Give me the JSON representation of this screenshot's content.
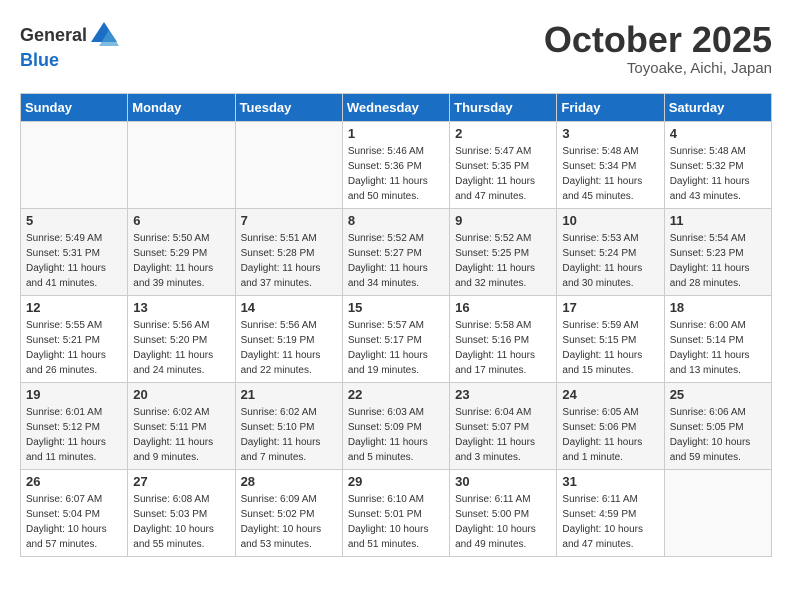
{
  "header": {
    "logo_general": "General",
    "logo_blue": "Blue",
    "month_title": "October 2025",
    "subtitle": "Toyoake, Aichi, Japan"
  },
  "weekdays": [
    "Sunday",
    "Monday",
    "Tuesday",
    "Wednesday",
    "Thursday",
    "Friday",
    "Saturday"
  ],
  "weeks": [
    [
      {
        "day": "",
        "info": ""
      },
      {
        "day": "",
        "info": ""
      },
      {
        "day": "",
        "info": ""
      },
      {
        "day": "1",
        "info": "Sunrise: 5:46 AM\nSunset: 5:36 PM\nDaylight: 11 hours\nand 50 minutes."
      },
      {
        "day": "2",
        "info": "Sunrise: 5:47 AM\nSunset: 5:35 PM\nDaylight: 11 hours\nand 47 minutes."
      },
      {
        "day": "3",
        "info": "Sunrise: 5:48 AM\nSunset: 5:34 PM\nDaylight: 11 hours\nand 45 minutes."
      },
      {
        "day": "4",
        "info": "Sunrise: 5:48 AM\nSunset: 5:32 PM\nDaylight: 11 hours\nand 43 minutes."
      }
    ],
    [
      {
        "day": "5",
        "info": "Sunrise: 5:49 AM\nSunset: 5:31 PM\nDaylight: 11 hours\nand 41 minutes."
      },
      {
        "day": "6",
        "info": "Sunrise: 5:50 AM\nSunset: 5:29 PM\nDaylight: 11 hours\nand 39 minutes."
      },
      {
        "day": "7",
        "info": "Sunrise: 5:51 AM\nSunset: 5:28 PM\nDaylight: 11 hours\nand 37 minutes."
      },
      {
        "day": "8",
        "info": "Sunrise: 5:52 AM\nSunset: 5:27 PM\nDaylight: 11 hours\nand 34 minutes."
      },
      {
        "day": "9",
        "info": "Sunrise: 5:52 AM\nSunset: 5:25 PM\nDaylight: 11 hours\nand 32 minutes."
      },
      {
        "day": "10",
        "info": "Sunrise: 5:53 AM\nSunset: 5:24 PM\nDaylight: 11 hours\nand 30 minutes."
      },
      {
        "day": "11",
        "info": "Sunrise: 5:54 AM\nSunset: 5:23 PM\nDaylight: 11 hours\nand 28 minutes."
      }
    ],
    [
      {
        "day": "12",
        "info": "Sunrise: 5:55 AM\nSunset: 5:21 PM\nDaylight: 11 hours\nand 26 minutes."
      },
      {
        "day": "13",
        "info": "Sunrise: 5:56 AM\nSunset: 5:20 PM\nDaylight: 11 hours\nand 24 minutes."
      },
      {
        "day": "14",
        "info": "Sunrise: 5:56 AM\nSunset: 5:19 PM\nDaylight: 11 hours\nand 22 minutes."
      },
      {
        "day": "15",
        "info": "Sunrise: 5:57 AM\nSunset: 5:17 PM\nDaylight: 11 hours\nand 19 minutes."
      },
      {
        "day": "16",
        "info": "Sunrise: 5:58 AM\nSunset: 5:16 PM\nDaylight: 11 hours\nand 17 minutes."
      },
      {
        "day": "17",
        "info": "Sunrise: 5:59 AM\nSunset: 5:15 PM\nDaylight: 11 hours\nand 15 minutes."
      },
      {
        "day": "18",
        "info": "Sunrise: 6:00 AM\nSunset: 5:14 PM\nDaylight: 11 hours\nand 13 minutes."
      }
    ],
    [
      {
        "day": "19",
        "info": "Sunrise: 6:01 AM\nSunset: 5:12 PM\nDaylight: 11 hours\nand 11 minutes."
      },
      {
        "day": "20",
        "info": "Sunrise: 6:02 AM\nSunset: 5:11 PM\nDaylight: 11 hours\nand 9 minutes."
      },
      {
        "day": "21",
        "info": "Sunrise: 6:02 AM\nSunset: 5:10 PM\nDaylight: 11 hours\nand 7 minutes."
      },
      {
        "day": "22",
        "info": "Sunrise: 6:03 AM\nSunset: 5:09 PM\nDaylight: 11 hours\nand 5 minutes."
      },
      {
        "day": "23",
        "info": "Sunrise: 6:04 AM\nSunset: 5:07 PM\nDaylight: 11 hours\nand 3 minutes."
      },
      {
        "day": "24",
        "info": "Sunrise: 6:05 AM\nSunset: 5:06 PM\nDaylight: 11 hours\nand 1 minute."
      },
      {
        "day": "25",
        "info": "Sunrise: 6:06 AM\nSunset: 5:05 PM\nDaylight: 10 hours\nand 59 minutes."
      }
    ],
    [
      {
        "day": "26",
        "info": "Sunrise: 6:07 AM\nSunset: 5:04 PM\nDaylight: 10 hours\nand 57 minutes."
      },
      {
        "day": "27",
        "info": "Sunrise: 6:08 AM\nSunset: 5:03 PM\nDaylight: 10 hours\nand 55 minutes."
      },
      {
        "day": "28",
        "info": "Sunrise: 6:09 AM\nSunset: 5:02 PM\nDaylight: 10 hours\nand 53 minutes."
      },
      {
        "day": "29",
        "info": "Sunrise: 6:10 AM\nSunset: 5:01 PM\nDaylight: 10 hours\nand 51 minutes."
      },
      {
        "day": "30",
        "info": "Sunrise: 6:11 AM\nSunset: 5:00 PM\nDaylight: 10 hours\nand 49 minutes."
      },
      {
        "day": "31",
        "info": "Sunrise: 6:11 AM\nSunset: 4:59 PM\nDaylight: 10 hours\nand 47 minutes."
      },
      {
        "day": "",
        "info": ""
      }
    ]
  ]
}
